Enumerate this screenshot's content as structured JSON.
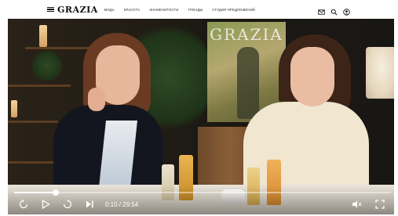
{
  "header": {
    "logo": "GRAZIA",
    "nav": [
      "МОДА",
      "КРАСОТА",
      "ЗНАМЕНИТОСТИ",
      "ТРЕНДЫ",
      "СТУДИЯ ПРЕДЛОЖЕНИЙ"
    ],
    "icons": [
      "mail-icon",
      "search-icon",
      "user-icon"
    ]
  },
  "video": {
    "poster_text": "GRAZIA",
    "progress": 0.11,
    "time": "0:10 / 29:54"
  },
  "colors": {
    "header_bg": "#ffffff",
    "text": "#111111",
    "progress_track": "rgba(255,255,255,0.45)",
    "progress_fill": "#ffffff"
  }
}
